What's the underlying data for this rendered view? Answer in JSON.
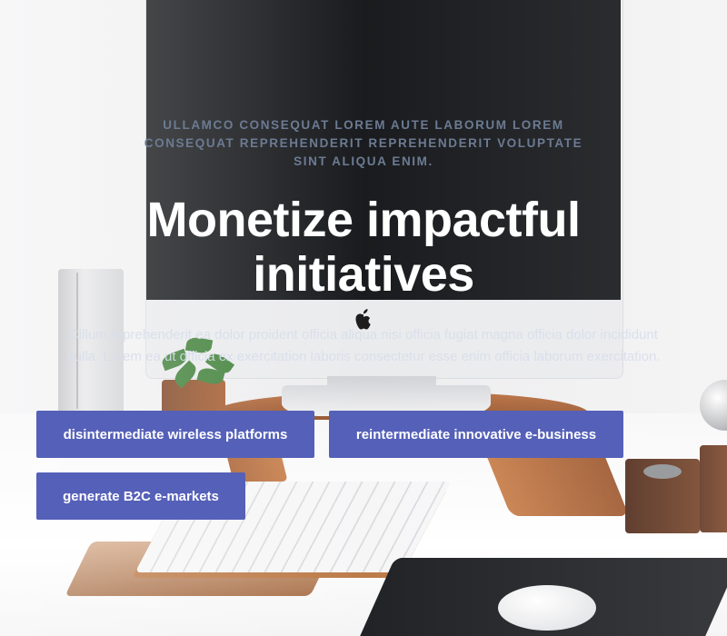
{
  "hero": {
    "eyebrow": "ULLAMCO CONSEQUAT LOREM AUTE LABORUM LOREM CONSEQUAT REPREHENDERIT REPREHENDERIT VOLUPTATE SINT ALIQUA ENIM.",
    "title": "Monetize impactful initiatives",
    "lead": "Cillum reprehenderit ea dolor proident officia aliqua nisi officia fugiat magna officia dolor incididunt nulla. Lorem ea ut officia ex exercitation laboris consectetur esse enim officia laborum exercitation.",
    "buttons": [
      {
        "label": "disintermediate wireless platforms"
      },
      {
        "label": "reintermediate innovative e-business"
      },
      {
        "label": "generate B2C e-markets"
      }
    ]
  },
  "colors": {
    "button_bg": "#5560b8",
    "eyebrow_text": "#6c7b93",
    "title_text": "#ffffff"
  }
}
